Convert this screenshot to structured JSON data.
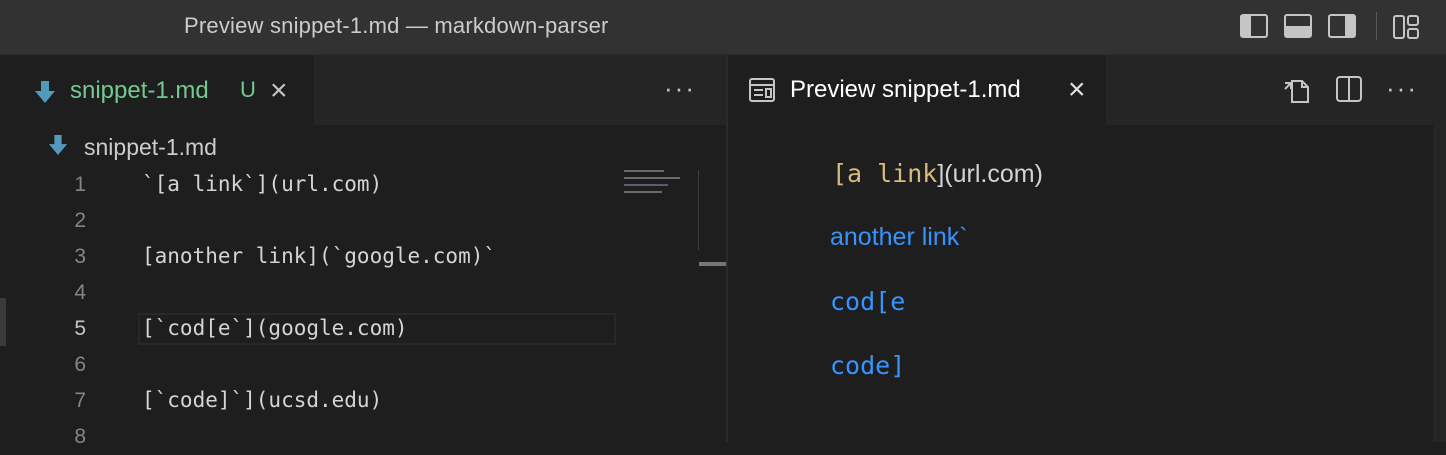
{
  "window": {
    "title": "Preview snippet-1.md — markdown-parser"
  },
  "layout_controls": [
    {
      "name": "toggle-primary-sidebar-icon"
    },
    {
      "name": "toggle-panel-icon"
    },
    {
      "name": "toggle-secondary-sidebar-icon"
    },
    {
      "name": "customize-layout-icon"
    }
  ],
  "editor": {
    "tab": {
      "label": "snippet-1.md",
      "status": "U"
    },
    "breadcrumb": "snippet-1.md",
    "lines": [
      {
        "n": "1",
        "text": "`[a link`](url.com)"
      },
      {
        "n": "2",
        "text": ""
      },
      {
        "n": "3",
        "text": "[another link](`google.com)`"
      },
      {
        "n": "4",
        "text": ""
      },
      {
        "n": "5",
        "text": "[`cod[e`](google.com)"
      },
      {
        "n": "6",
        "text": ""
      },
      {
        "n": "7",
        "text": "[`code]`](ucsd.edu)"
      },
      {
        "n": "8",
        "text": ""
      }
    ]
  },
  "preview": {
    "tab": {
      "label": "Preview snippet-1.md"
    },
    "p1_code": "[a link",
    "p1_text": "](url.com)",
    "link1": "another link`",
    "link2": "cod[e",
    "link3": "code]"
  },
  "colors": {
    "background": "#1e1e1e",
    "tab_untracked": "#73c991",
    "link": "#3794ff",
    "code_string": "#ce9178",
    "preview_code": "#d7ba7d"
  }
}
